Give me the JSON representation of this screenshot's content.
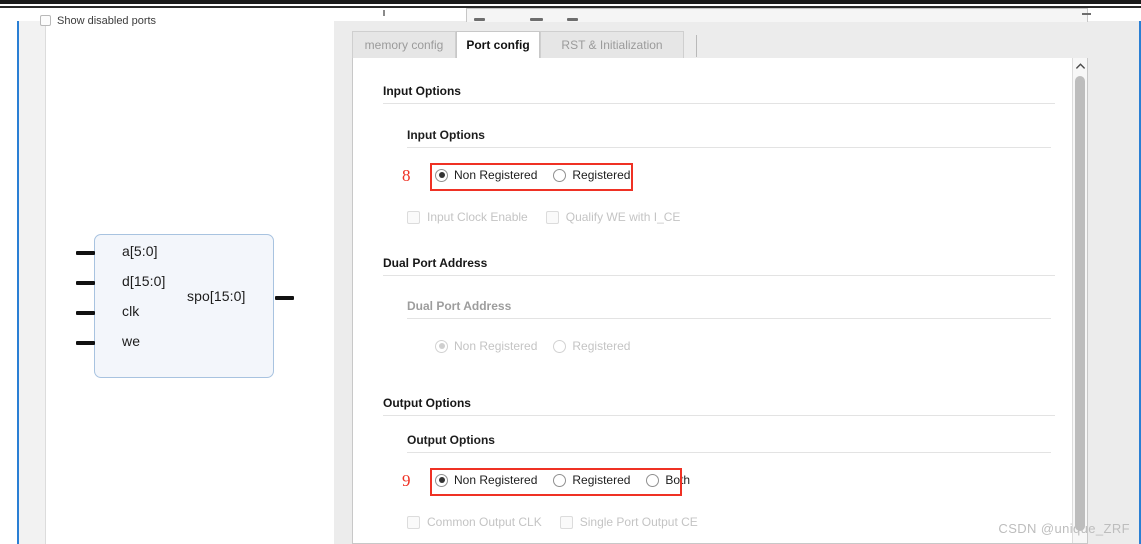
{
  "window": {
    "left_checkbox_label": "Show disabled ports"
  },
  "symbol": {
    "name": "dist-mem-symbol",
    "inputs": [
      "a[5:0]",
      "d[15:0]",
      "clk",
      "we"
    ],
    "outputs": [
      "spo[15:0]"
    ]
  },
  "tabs": [
    {
      "label": "memory config",
      "active": false
    },
    {
      "label": "Port config",
      "active": true
    },
    {
      "label": "RST & Initialization",
      "active": false
    }
  ],
  "sections": {
    "input_options": {
      "heading": "Input Options",
      "subheading": "Input Options",
      "radios": [
        {
          "label": "Non Registered",
          "checked": true,
          "disabled": false
        },
        {
          "label": "Registered",
          "checked": false,
          "disabled": false
        }
      ],
      "checkboxes": [
        {
          "label": "Input Clock Enable",
          "checked": false,
          "disabled": true
        },
        {
          "label": "Qualify WE with I_CE",
          "checked": false,
          "disabled": true
        }
      ],
      "annotation": "8"
    },
    "dual_port_address": {
      "heading": "Dual Port Address",
      "subheading": "Dual Port Address",
      "radios": [
        {
          "label": "Non Registered",
          "checked": true,
          "disabled": true
        },
        {
          "label": "Registered",
          "checked": false,
          "disabled": true
        }
      ]
    },
    "output_options": {
      "heading": "Output Options",
      "subheading": "Output Options",
      "radios": [
        {
          "label": "Non Registered",
          "checked": true,
          "disabled": false
        },
        {
          "label": "Registered",
          "checked": false,
          "disabled": false
        },
        {
          "label": "Both",
          "checked": false,
          "disabled": false
        }
      ],
      "checkboxes": [
        {
          "label": "Common Output CLK",
          "checked": false,
          "disabled": true
        },
        {
          "label": "Single Port Output CE",
          "checked": false,
          "disabled": true
        }
      ],
      "annotation": "9"
    }
  },
  "scrollbar": {
    "up_arrow": "chevron-up-icon"
  },
  "watermark": "CSDN @unique_ZRF",
  "colors": {
    "annotation_red": "#ef3124",
    "panel_blue_edge": "#2a7fd4",
    "symbol_fill": "#f3f6fb",
    "symbol_border": "#a8c3e0"
  }
}
